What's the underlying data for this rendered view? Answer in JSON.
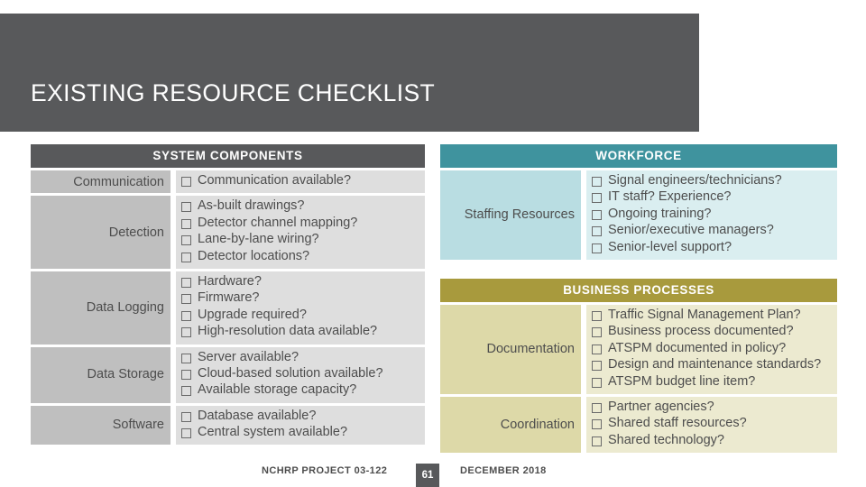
{
  "slide": {
    "title": "EXISTING RESOURCE CHECKLIST",
    "accent_dark": "#58595B",
    "accent_teal": "#3F939E",
    "accent_gold": "#A89A3D"
  },
  "tables": {
    "system_components": {
      "header": "SYSTEM COMPONENTS",
      "rows": [
        {
          "label": "Communication",
          "items": [
            "Communication available?"
          ]
        },
        {
          "label": "Detection",
          "items": [
            "As-built drawings?",
            "Detector channel mapping?",
            "Lane-by-lane wiring?",
            "Detector locations?"
          ]
        },
        {
          "label": "Data Logging",
          "items": [
            "Hardware?",
            "Firmware?",
            "Upgrade required?",
            "High-resolution data available?"
          ]
        },
        {
          "label": "Data Storage",
          "items": [
            "Server available?",
            "Cloud-based solution available?",
            "Available storage capacity?"
          ]
        },
        {
          "label": "Software",
          "items": [
            "Database available?",
            "Central system available?"
          ]
        }
      ]
    },
    "workforce": {
      "header": "WORKFORCE",
      "rows": [
        {
          "label": "Staffing Resources",
          "items": [
            "Signal engineers/technicians?",
            "IT staff? Experience?",
            "Ongoing training?",
            "Senior/executive managers?",
            "Senior-level support?"
          ]
        }
      ]
    },
    "business_processes": {
      "header": "BUSINESS PROCESSES",
      "rows": [
        {
          "label": "Documentation",
          "items": [
            "Traffic Signal Management Plan?",
            "Business process documented?",
            "ATSPM documented in policy?",
            "Design and maintenance standards?",
            "ATSPM budget line item?"
          ]
        },
        {
          "label": "Coordination",
          "items": [
            "Partner agencies?",
            "Shared staff resources?",
            "Shared technology?"
          ]
        }
      ]
    }
  },
  "footer": {
    "project": "NCHRP PROJECT 03-122",
    "date": "DECEMBER 2018",
    "page_number": "61"
  }
}
